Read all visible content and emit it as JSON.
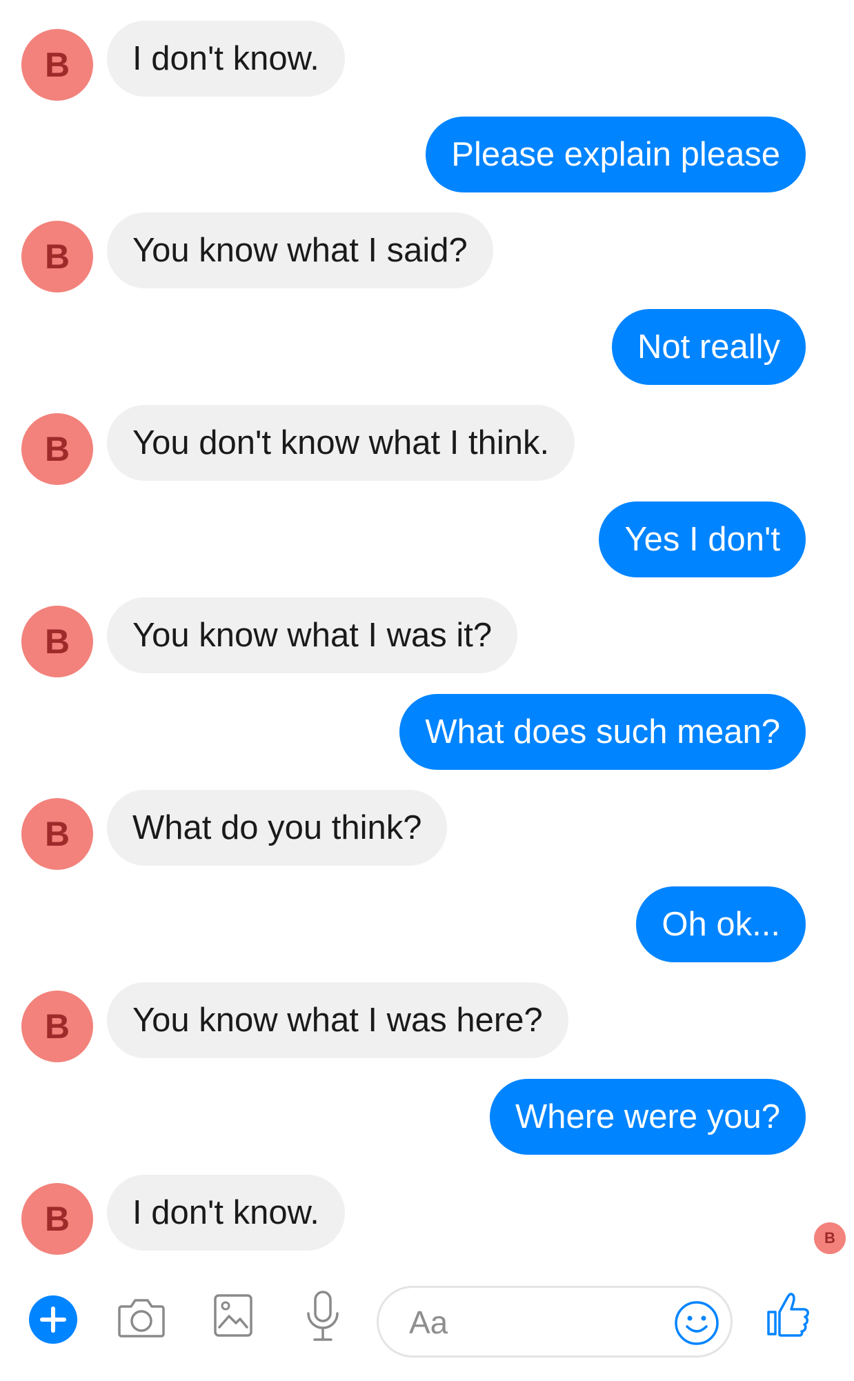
{
  "conversation": {
    "contact_initial": "B",
    "messages": [
      {
        "sender": "contact",
        "text": "I don't know."
      },
      {
        "sender": "me",
        "text": "Please explain please"
      },
      {
        "sender": "contact",
        "text": "You know what I said?"
      },
      {
        "sender": "me",
        "text": "Not really"
      },
      {
        "sender": "contact",
        "text": "You don't know what I think."
      },
      {
        "sender": "me",
        "text": "Yes I don't"
      },
      {
        "sender": "contact",
        "text": "You know what I was it?"
      },
      {
        "sender": "me",
        "text": "What does such mean?"
      },
      {
        "sender": "contact",
        "text": "What do you think?"
      },
      {
        "sender": "me",
        "text": "Oh ok..."
      },
      {
        "sender": "contact",
        "text": "You know what I was here?"
      },
      {
        "sender": "me",
        "text": "Where were you?"
      },
      {
        "sender": "contact",
        "text": "I don't know."
      }
    ],
    "seen_indicator_initial": "B"
  },
  "composer": {
    "placeholder": "Aa",
    "icons": [
      "plus-icon",
      "camera-icon",
      "gallery-icon",
      "microphone-icon",
      "emoji-icon",
      "thumbs-up-icon"
    ]
  },
  "colors": {
    "outgoing_bubble": "#0084ff",
    "incoming_bubble": "#f0f0f0",
    "avatar": "#f2827b",
    "avatar_text": "#9e2a2a",
    "accent": "#0084ff"
  }
}
